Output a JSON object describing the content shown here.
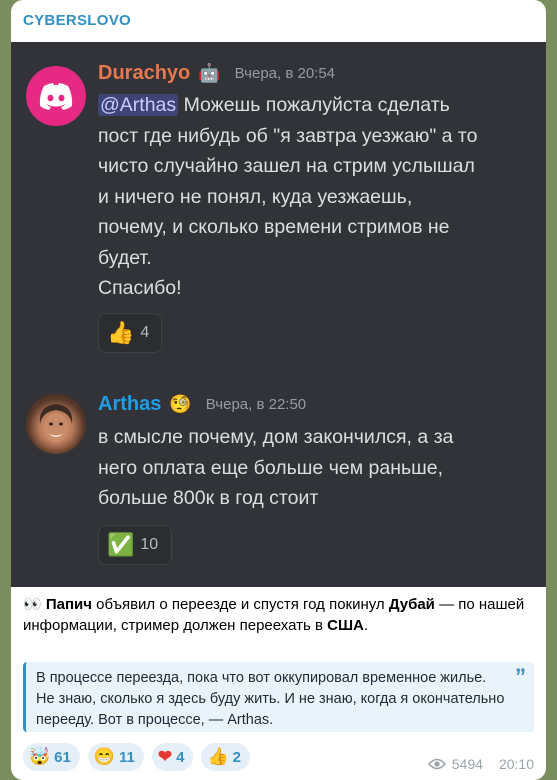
{
  "channel": {
    "name": "CYBERSLOVO"
  },
  "screenshot": {
    "message1": {
      "username": "Durachyo",
      "badge_icon": "robot-face-emoji",
      "time": "Вчера, в 20:54",
      "mention": "@Arthas",
      "text": " Можешь пожалуйста сделать\nпост где нибудь об \"я завтра уезжаю\" а то\nчисто случайно зашел на стрим услышал\nи ничего не понял, куда уезжаешь,\nпочему, и сколько времени стримов не\nбудет.\nСпасибо!",
      "reaction": {
        "emoji": "👍",
        "count": "4"
      }
    },
    "message2": {
      "username": "Arthas",
      "badge_icon": "face-with-monocle-emoji",
      "time": "Вчера, в 22:50",
      "text": "в смысле почему, дом закончился, а за\nнего оплата еще больше чем раньше,\nбольше 800к в год стоит",
      "reaction": {
        "emoji": "✅",
        "count": "10"
      }
    }
  },
  "post": {
    "eyes": "👀",
    "name": "Папич",
    "part1": " объявил о переезде и спустя год покинул ",
    "place1": "Дубай",
    "part2": " — по нашей информации, стример должен переехать в ",
    "place2": "США",
    "part3": "."
  },
  "quote": {
    "text": "В процессе переезда, пока что вот оккупировал временное жилье. Не знаю, сколько я здесь буду жить. И не знаю, когда я окончательно перееду. Вот в процессе, — Arthas."
  },
  "reactions": [
    {
      "emoji": "🤯",
      "count": "61"
    },
    {
      "emoji": "😁",
      "count": "11"
    },
    {
      "emoji": "❤",
      "count": "4"
    },
    {
      "emoji": "👍",
      "count": "2"
    }
  ],
  "meta": {
    "views": "5494",
    "time": "20:10"
  },
  "colors": {
    "durachyo_name": "#e8774e",
    "arthas_name": "#1e9ee8",
    "accent": "#3390c1"
  }
}
